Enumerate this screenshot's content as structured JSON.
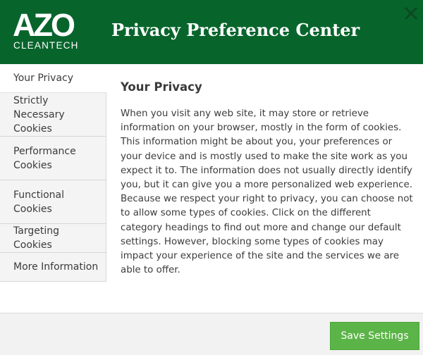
{
  "header": {
    "logo_main": "AZO",
    "logo_sub": "CLEANTECH",
    "title": "Privacy Preference Center",
    "close_icon": "close-icon"
  },
  "sidebar": {
    "items": [
      {
        "label": "Your Privacy",
        "active": true
      },
      {
        "label": "Strictly Necessary Cookies",
        "active": false
      },
      {
        "label": "Performance Cookies",
        "active": false
      },
      {
        "label": "Functional Cookies",
        "active": false
      },
      {
        "label": "Targeting Cookies",
        "active": false
      },
      {
        "label": "More Information",
        "active": false
      }
    ]
  },
  "content": {
    "title": "Your Privacy",
    "body": "When you visit any web site, it may store or retrieve information on your browser, mostly in the form of cookies. This information might be about you, your preferences or your device and is mostly used to make the site work as you expect it to. The information does not usually directly identify you, but it can give you a more personalized web experience. Because we respect your right to privacy, you can choose not to allow some types of cookies. Click on the different category headings to find out more and change our default settings. However, blocking some types of cookies may impact your experience of the site and the services we are able to offer."
  },
  "footer": {
    "save_label": "Save Settings"
  },
  "colors": {
    "header_bg": "#07652c",
    "save_button": "#5bb447",
    "close_icon": "#0b4a22",
    "sidebar_bg": "#f4f4f4",
    "text": "#3b3b3b"
  }
}
